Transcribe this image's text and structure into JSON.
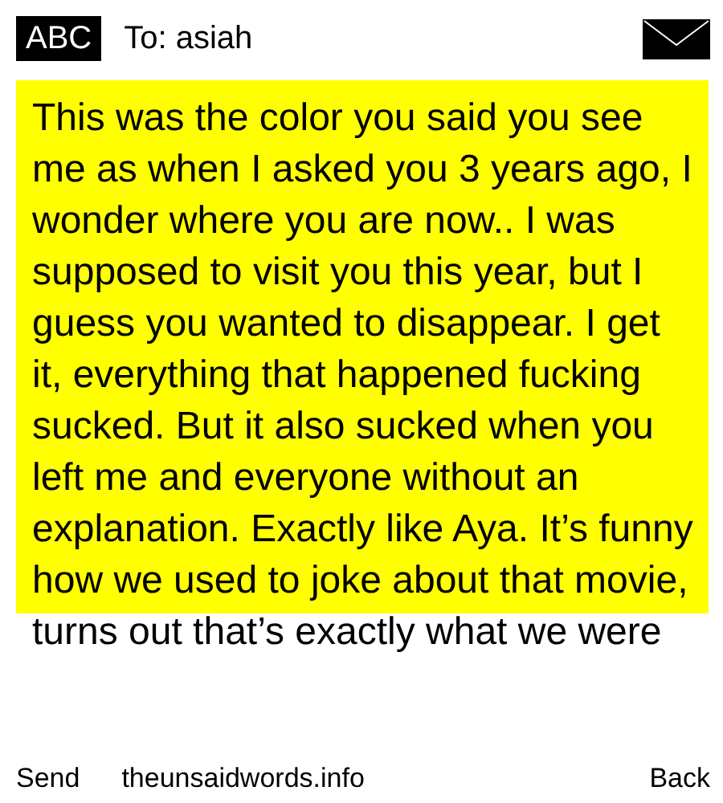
{
  "header": {
    "mode": "ABC",
    "recipient": "To: asiah"
  },
  "message": {
    "text": "This was the color you said you see me as when I asked you 3 years ago, I wonder where you are now.. I was supposed to visit you this year, but I guess you wanted to disappear. I get it, everything that happened fucking sucked. But it also sucked when you left me and everyone without an explanation. Exactly like Aya. It’s funny how we used to joke about that movie, turns out that’s exactly what we were",
    "color": "#ffff00"
  },
  "softkeys": {
    "left": "Send",
    "center": "theunsaidwords.info",
    "right": "Back"
  }
}
